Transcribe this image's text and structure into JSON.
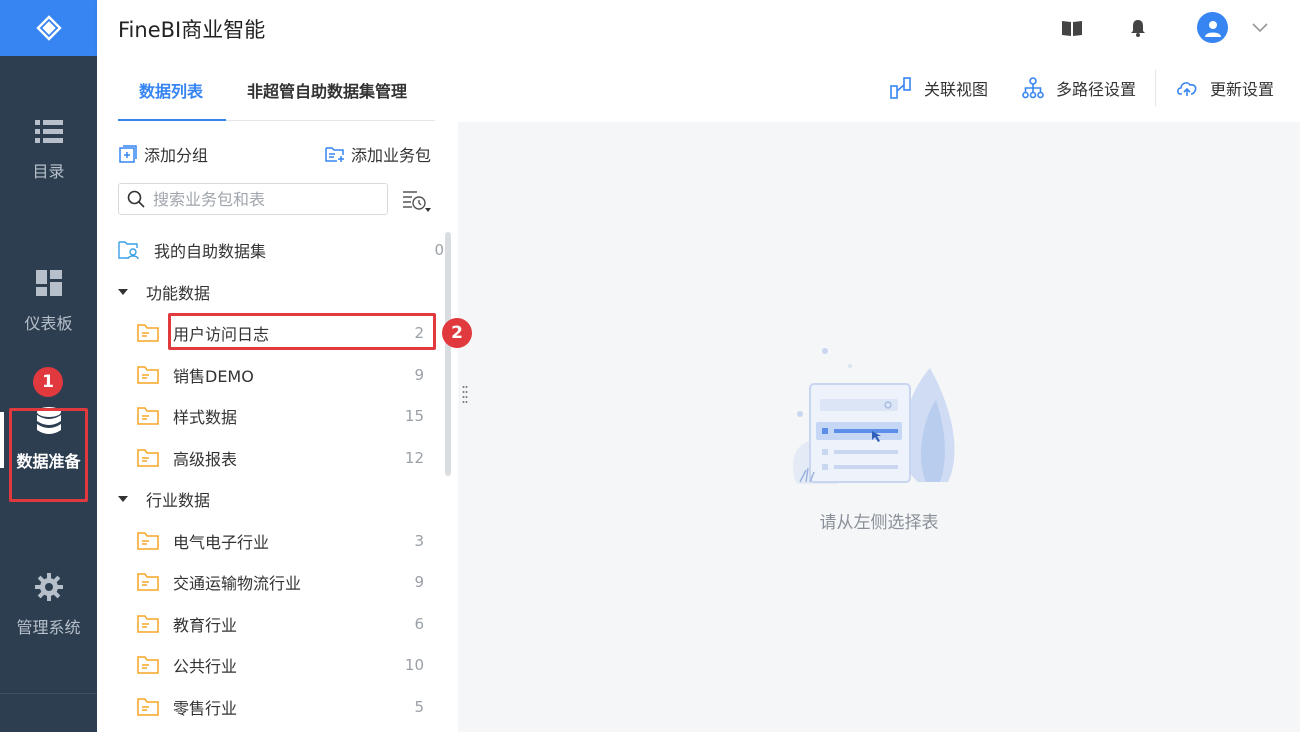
{
  "app": {
    "title": "FineBI商业智能"
  },
  "nav": {
    "items": [
      {
        "label": "目录",
        "icon": "list-icon"
      },
      {
        "label": "仪表板",
        "icon": "dashboard-icon"
      },
      {
        "label": "数据准备",
        "icon": "database-icon",
        "active": true
      },
      {
        "label": "管理系统",
        "icon": "gear-icon"
      }
    ]
  },
  "tabs": {
    "data_list": "数据列表",
    "self_dataset_mgmt": "非超管自助数据集管理"
  },
  "actions": {
    "relation_view": "关联视图",
    "multipath": "多路径设置",
    "update": "更新设置"
  },
  "panel": {
    "add_group": "添加分组",
    "add_package": "添加业务包",
    "search_placeholder": "搜索业务包和表",
    "my_dataset": {
      "label": "我的自助数据集",
      "count": "0"
    },
    "groups": [
      {
        "label": "功能数据",
        "items": [
          {
            "label": "用户访问日志",
            "count": "2"
          },
          {
            "label": "销售DEMO",
            "count": "9"
          },
          {
            "label": "样式数据",
            "count": "15"
          },
          {
            "label": "高级报表",
            "count": "12"
          }
        ]
      },
      {
        "label": "行业数据",
        "items": [
          {
            "label": "电气电子行业",
            "count": "3"
          },
          {
            "label": "交通运输物流行业",
            "count": "9"
          },
          {
            "label": "教育行业",
            "count": "6"
          },
          {
            "label": "公共行业",
            "count": "10"
          },
          {
            "label": "零售行业",
            "count": "5"
          }
        ]
      }
    ]
  },
  "content": {
    "empty_text": "请从左侧选择表"
  },
  "callouts": {
    "one": "1",
    "two": "2"
  },
  "colors": {
    "accent": "#3685f2",
    "nav_bg": "#2c3e50",
    "callout": "#e0393e",
    "folder": "#f5a623"
  }
}
